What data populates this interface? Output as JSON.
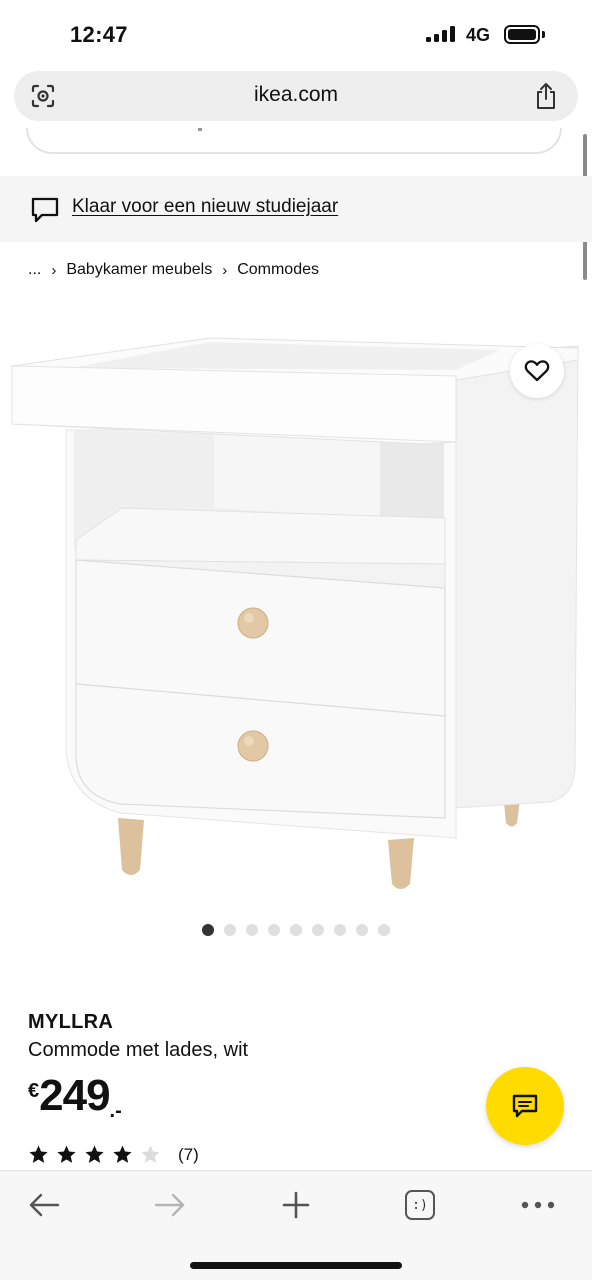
{
  "status_bar": {
    "time": "12:47",
    "network": "4G",
    "icons": [
      "signal-icon",
      "battery-icon"
    ]
  },
  "browser": {
    "url": "ikea.com",
    "left_icon": "page-tools-icon",
    "share_icon": "share-icon"
  },
  "banner": {
    "icon": "chat-bubble-icon",
    "text": "Klaar voor een nieuw studiejaar"
  },
  "breadcrumb": {
    "items": [
      "...",
      "Babykamer meubels",
      "Commodes"
    ]
  },
  "carousel": {
    "total": 9,
    "active_index": 0
  },
  "product": {
    "name": "MYLLRA",
    "description": "Commode met lades, wit",
    "price_currency": "€",
    "price_amount": "249",
    "price_decimals": ".-",
    "rating_stars": 4,
    "rating_max": 5,
    "review_count": "(7)",
    "favorite_icon": "heart-icon"
  },
  "chat_button": {
    "icon": "chat-icon"
  },
  "toolbar": {
    "buttons": [
      "back-icon",
      "forward-icon",
      "new-tab-icon",
      "tabs-icon",
      "more-icon"
    ],
    "tabs_label": ":)"
  },
  "colors": {
    "accent_yellow": "#ffdb00",
    "banner_bg": "#f5f5f5",
    "address_bg": "#eeeeef"
  }
}
